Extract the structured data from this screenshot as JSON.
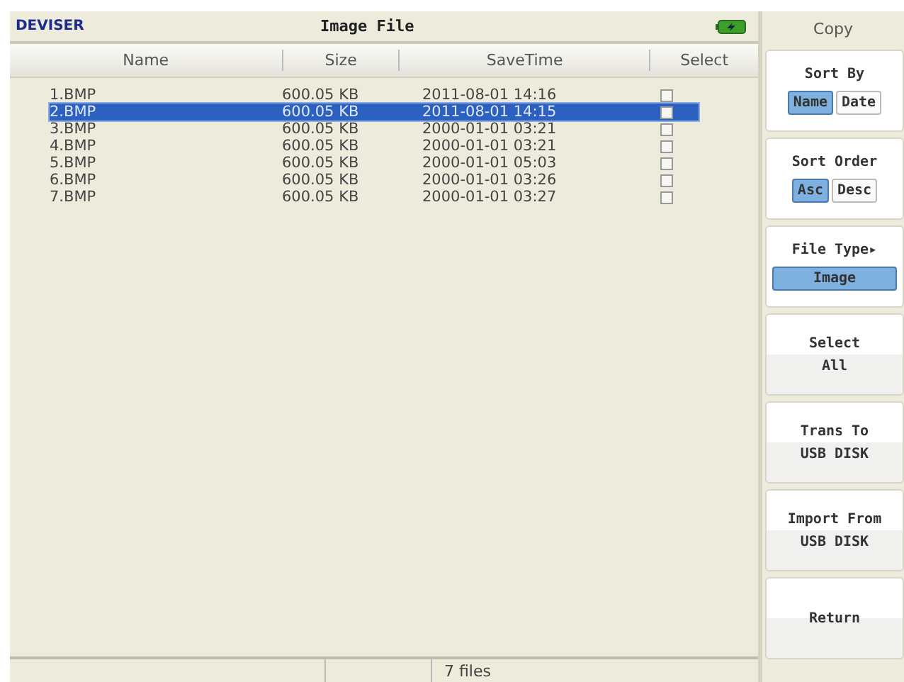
{
  "header": {
    "logo": "DEVISER",
    "title": "Image File"
  },
  "menu_title": "Copy",
  "table": {
    "columns": [
      "Name",
      "Size",
      "SaveTime",
      "Select"
    ],
    "rows": [
      {
        "name": "1.BMP",
        "size": "600.05 KB",
        "save_time": "2011-08-01 14:16",
        "checked": false,
        "selected": false
      },
      {
        "name": "2.BMP",
        "size": "600.05 KB",
        "save_time": "2011-08-01 14:15",
        "checked": false,
        "selected": true
      },
      {
        "name": "3.BMP",
        "size": "600.05 KB",
        "save_time": "2000-01-01 03:21",
        "checked": false,
        "selected": false
      },
      {
        "name": "4.BMP",
        "size": "600.05 KB",
        "save_time": "2000-01-01 03:21",
        "checked": false,
        "selected": false
      },
      {
        "name": "5.BMP",
        "size": "600.05 KB",
        "save_time": "2000-01-01 05:03",
        "checked": false,
        "selected": false
      },
      {
        "name": "6.BMP",
        "size": "600.05 KB",
        "save_time": "2000-01-01 03:26",
        "checked": false,
        "selected": false
      },
      {
        "name": "7.BMP",
        "size": "600.05 KB",
        "save_time": "2000-01-01 03:27",
        "checked": false,
        "selected": false
      }
    ]
  },
  "status_bar": {
    "count": "7 files"
  },
  "softkeys": [
    {
      "kind": "choice",
      "label": "Sort By",
      "options": [
        {
          "label": "Name",
          "selected": true
        },
        {
          "label": "Date",
          "selected": false
        }
      ]
    },
    {
      "kind": "choice",
      "label": "Sort Order",
      "options": [
        {
          "label": "Asc",
          "selected": true
        },
        {
          "label": "Desc",
          "selected": false
        }
      ]
    },
    {
      "kind": "choice",
      "label": "File Type▸",
      "options": [
        {
          "label": "Image",
          "selected": true
        }
      ]
    },
    {
      "kind": "action",
      "lines": [
        "Select",
        "All"
      ]
    },
    {
      "kind": "action",
      "lines": [
        "Trans To",
        "USB DISK"
      ]
    },
    {
      "kind": "action",
      "lines": [
        "Import From",
        "USB DISK"
      ]
    },
    {
      "kind": "action",
      "lines": [
        "Return"
      ]
    }
  ]
}
